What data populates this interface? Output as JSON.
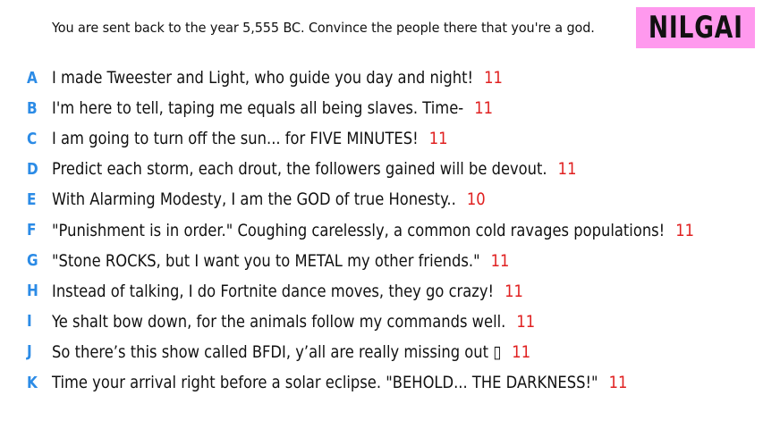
{
  "prompt": "You are sent back to the year 5,555 BC. Convince the people there that you're a god.",
  "badge": {
    "label": "NILGAI",
    "bg_color": "#ff99ee",
    "text_color": "#111111"
  },
  "colors": {
    "letter": "#2b8be6",
    "score": "#e02020"
  },
  "entries": [
    {
      "letter": "A",
      "text": "I made Tweester and Light, who guide you day and night!",
      "score": "11"
    },
    {
      "letter": "B",
      "text": "I'm here to tell, taping me equals all being slaves. Time-",
      "score": "11"
    },
    {
      "letter": "C",
      "text": "I am going to turn off the sun... for FIVE MINUTES!",
      "score": "11"
    },
    {
      "letter": "D",
      "text": "Predict each storm, each drout, the followers gained will be devout.",
      "score": "11"
    },
    {
      "letter": "E",
      "text": "With Alarming Modesty, I am the GOD of true Honesty..",
      "score": "10"
    },
    {
      "letter": "F",
      "text": "\"Punishment is in order.\" Coughing carelessly, a common cold ravages populations!",
      "score": "11"
    },
    {
      "letter": "G",
      "text": "\"Stone ROCKS, but I want you to METAL my other friends.\"",
      "score": "11"
    },
    {
      "letter": "H",
      "text": "Instead of talking, I do Fortnite dance moves, they go crazy!",
      "score": "11"
    },
    {
      "letter": "I",
      "text": "Ye shalt bow down, for the animals follow my commands well.",
      "score": "11"
    },
    {
      "letter": "J",
      "text": "So there’s this show called BFDI, y’all are really missing out ▯",
      "score": "11"
    },
    {
      "letter": "K",
      "text": "Time your arrival right before a solar eclipse. \"BEHOLD... THE DARKNESS!\"",
      "score": "11"
    }
  ]
}
